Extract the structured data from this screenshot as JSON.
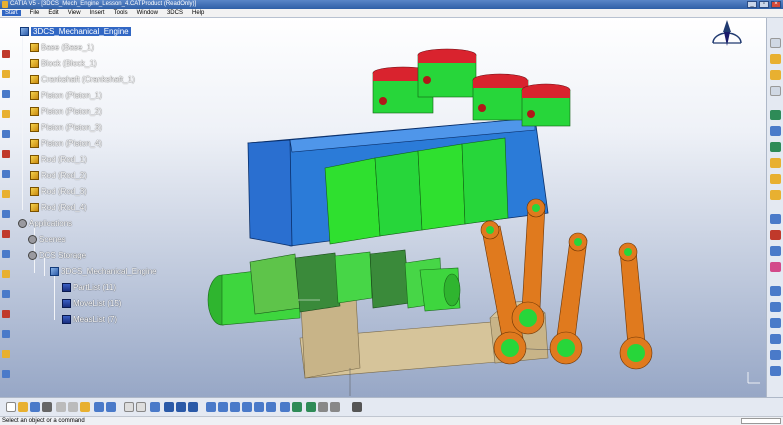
{
  "window": {
    "title": "CATIA V5 - [3DCS_Mech_Engine_Lesson_4.CATProduct (ReadOnly)]"
  },
  "menu": [
    "Start",
    "File",
    "Edit",
    "View",
    "Insert",
    "Tools",
    "Window",
    "3DCS",
    "Help"
  ],
  "tree": {
    "root": "3DCS_Mechanical_Engine",
    "parts": [
      "Base (Base_1)",
      "Block (Block_1)",
      "Crankshaft (Crankshaft_1)",
      "Piston (Piston_1)",
      "Piston (Piston_2)",
      "Piston (Piston_3)",
      "Piston (Piston_4)",
      "Rod (Rod_1)",
      "Rod (Rod_2)",
      "Rod (Rod_3)",
      "Rod (Rod_4)"
    ],
    "applications": "Applications",
    "scenes": "Scenes",
    "dcs_storage": "DCS Storage",
    "dcs_root": "3DCS_Mechanical_Engine",
    "lists": [
      "PartList (11)",
      "MoveList (15)",
      "MeasList (7)"
    ]
  },
  "status": {
    "message": "Select an object or a command"
  },
  "colors": {
    "block": "#2b7bd8",
    "piston_crown": "#d9232e",
    "piston_skirt": "#27d63a",
    "rod": "#e07a1e",
    "base": "#d6c49a",
    "selection": "#3167c4"
  }
}
